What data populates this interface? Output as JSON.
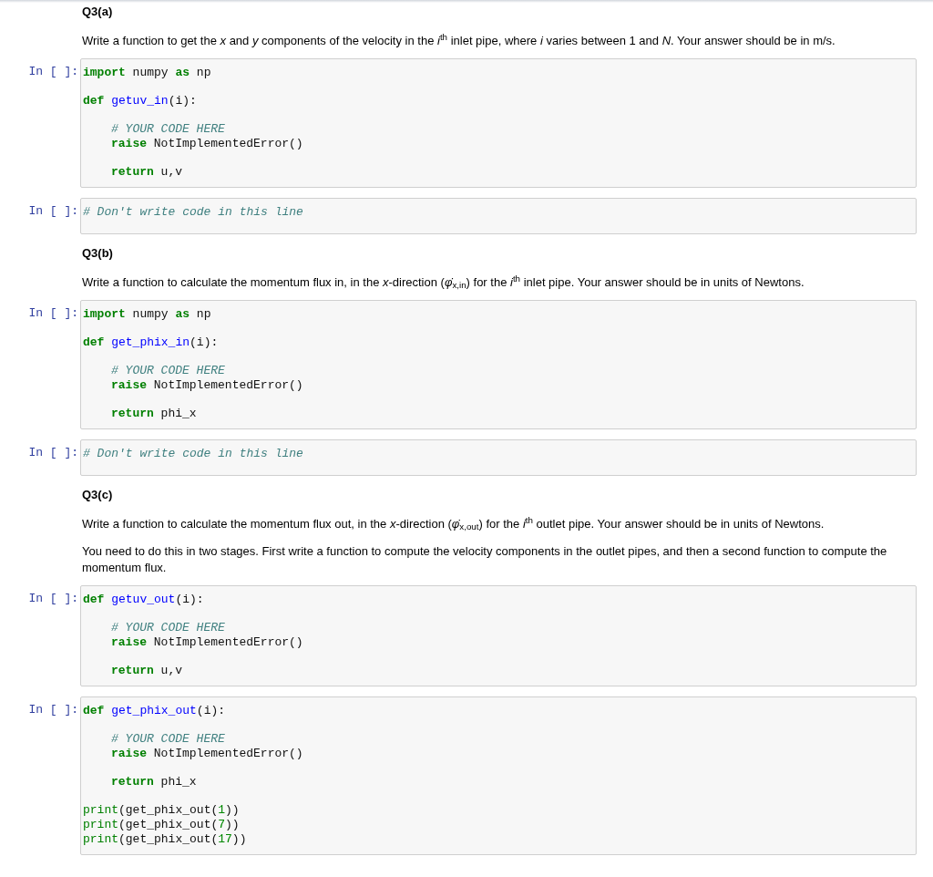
{
  "cells": [
    {
      "kind": "markdown",
      "heading": "Q3(a)",
      "paragraphs": [
        "Write a function to get the *x* and *y* components of the velocity in the *i*$^{th}$ inlet pipe, where *i* varies between 1 and *N*. Your answer should be in m/s."
      ]
    },
    {
      "kind": "code",
      "prompt": "In [ ]:",
      "blocks": [
        [
          {
            "indented": false,
            "tokens": [
              {
                "kind": "kw",
                "text": "import"
              },
              {
                "kind": "plain",
                "text": " numpy "
              },
              {
                "kind": "kw",
                "text": "as"
              },
              {
                "kind": "plain",
                "text": " np"
              }
            ]
          }
        ],
        [
          {
            "indented": false,
            "tokens": [
              {
                "kind": "kw",
                "text": "def"
              },
              {
                "kind": "fn",
                "text": " getuv_in"
              },
              {
                "kind": "plain",
                "text": "(i):"
              }
            ]
          }
        ],
        [
          {
            "indented": true,
            "tokens": [
              {
                "kind": "comment",
                "text": "# YOUR CODE HERE"
              }
            ]
          },
          {
            "indented": true,
            "tokens": [
              {
                "kind": "kw",
                "text": "raise"
              },
              {
                "kind": "plain",
                "text": " NotImplementedError()"
              }
            ]
          }
        ],
        [
          {
            "indented": true,
            "tokens": [
              {
                "kind": "kw",
                "text": "return"
              },
              {
                "kind": "plain",
                "text": " u,v"
              }
            ]
          }
        ]
      ]
    },
    {
      "kind": "code",
      "prompt": "In [ ]:",
      "blocks": [
        [
          {
            "indented": false,
            "tokens": [
              {
                "kind": "comment",
                "text": "# Don't write code in this line"
              }
            ]
          }
        ]
      ]
    },
    {
      "kind": "markdown",
      "heading": "Q3(b)",
      "paragraphs": [
        "Write a function to calculate the momentum flux in, in the *x*-direction (*φ̇*$_{x,in}$) for the *i*$^{th}$ inlet pipe. Your answer should be in units of Newtons."
      ]
    },
    {
      "kind": "code",
      "prompt": "In [ ]:",
      "blocks": [
        [
          {
            "indented": false,
            "tokens": [
              {
                "kind": "kw",
                "text": "import"
              },
              {
                "kind": "plain",
                "text": " numpy "
              },
              {
                "kind": "kw",
                "text": "as"
              },
              {
                "kind": "plain",
                "text": " np"
              }
            ]
          }
        ],
        [
          {
            "indented": false,
            "tokens": [
              {
                "kind": "kw",
                "text": "def"
              },
              {
                "kind": "fn",
                "text": " get_phix_in"
              },
              {
                "kind": "plain",
                "text": "(i):"
              }
            ]
          }
        ],
        [
          {
            "indented": true,
            "tokens": [
              {
                "kind": "comment",
                "text": "# YOUR CODE HERE"
              }
            ]
          },
          {
            "indented": true,
            "tokens": [
              {
                "kind": "kw",
                "text": "raise"
              },
              {
                "kind": "plain",
                "text": " NotImplementedError()"
              }
            ]
          }
        ],
        [
          {
            "indented": true,
            "tokens": [
              {
                "kind": "kw",
                "text": "return"
              },
              {
                "kind": "plain",
                "text": " phi_x"
              }
            ]
          }
        ]
      ]
    },
    {
      "kind": "code",
      "prompt": "In [ ]:",
      "blocks": [
        [
          {
            "indented": false,
            "tokens": [
              {
                "kind": "comment",
                "text": "# Don't write code in this line"
              }
            ]
          }
        ]
      ]
    },
    {
      "kind": "markdown",
      "heading": "Q3(c)",
      "paragraphs": [
        "Write a function to calculate the momentum flux out, in the *x*-direction (*φ̇*$_{x,out}$) for the *i*$^{th}$ outlet pipe. Your answer should be in units of Newtons.",
        "You need to do this in two stages. First write a function to compute the velocity components in the outlet pipes, and then a second function to compute the momentum flux."
      ]
    },
    {
      "kind": "code",
      "prompt": "In [ ]:",
      "blocks": [
        [
          {
            "indented": false,
            "tokens": [
              {
                "kind": "kw",
                "text": "def"
              },
              {
                "kind": "fn",
                "text": " getuv_out"
              },
              {
                "kind": "plain",
                "text": "(i):"
              }
            ]
          }
        ],
        [
          {
            "indented": true,
            "tokens": [
              {
                "kind": "comment",
                "text": "# YOUR CODE HERE"
              }
            ]
          },
          {
            "indented": true,
            "tokens": [
              {
                "kind": "kw",
                "text": "raise"
              },
              {
                "kind": "plain",
                "text": " NotImplementedError()"
              }
            ]
          }
        ],
        [
          {
            "indented": true,
            "tokens": [
              {
                "kind": "kw",
                "text": "return"
              },
              {
                "kind": "plain",
                "text": " u,v"
              }
            ]
          }
        ]
      ]
    },
    {
      "kind": "code",
      "prompt": "In [ ]:",
      "blocks": [
        [
          {
            "indented": false,
            "tokens": [
              {
                "kind": "kw",
                "text": "def"
              },
              {
                "kind": "fn",
                "text": " get_phix_out"
              },
              {
                "kind": "plain",
                "text": "(i):"
              }
            ]
          }
        ],
        [
          {
            "indented": true,
            "tokens": [
              {
                "kind": "comment",
                "text": "# YOUR CODE HERE"
              }
            ]
          },
          {
            "indented": true,
            "tokens": [
              {
                "kind": "kw",
                "text": "raise"
              },
              {
                "kind": "plain",
                "text": " NotImplementedError()"
              }
            ]
          }
        ],
        [
          {
            "indented": true,
            "tokens": [
              {
                "kind": "kw",
                "text": "return"
              },
              {
                "kind": "plain",
                "text": " phi_x"
              }
            ]
          }
        ],
        [
          {
            "indented": false,
            "tokens": [
              {
                "kind": "builtin",
                "text": "print"
              },
              {
                "kind": "plain",
                "text": "(get_phix_out("
              },
              {
                "kind": "num",
                "text": "1"
              },
              {
                "kind": "plain",
                "text": "))"
              }
            ]
          },
          {
            "indented": false,
            "tokens": [
              {
                "kind": "builtin",
                "text": "print"
              },
              {
                "kind": "plain",
                "text": "(get_phix_out("
              },
              {
                "kind": "num",
                "text": "7"
              },
              {
                "kind": "plain",
                "text": "))"
              }
            ]
          },
          {
            "indented": false,
            "tokens": [
              {
                "kind": "builtin",
                "text": "print"
              },
              {
                "kind": "plain",
                "text": "(get_phix_out("
              },
              {
                "kind": "num",
                "text": "17"
              },
              {
                "kind": "plain",
                "text": "))"
              }
            ]
          }
        ]
      ]
    }
  ]
}
